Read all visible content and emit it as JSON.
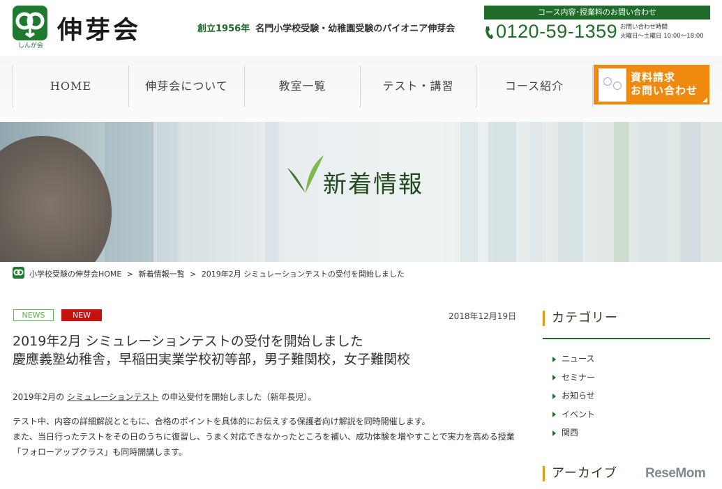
{
  "header": {
    "logo_text": "伸芽会",
    "logo_sub": "しんが会",
    "tagline_founded": "創立1956年",
    "tagline": "名門小学校受験・幼稚園受験のパイオニア伸芽会",
    "inquiry_bar": "コース内容･授業料のお問い合わせ",
    "phone": "0120-59-1359",
    "hours_label": "お問い合わせ時間",
    "hours_value": "火曜日～土曜日 10:00～18:00"
  },
  "nav": {
    "items": [
      {
        "label": "HOME"
      },
      {
        "label": "伸芽会について"
      },
      {
        "label": "教室一覧"
      },
      {
        "label": "テスト・講習"
      },
      {
        "label": "コース紹介"
      }
    ],
    "cta_line1": "資料請求",
    "cta_line2": "お問い合わせ"
  },
  "hero": {
    "title": "新着情報"
  },
  "breadcrumb": {
    "home": "小学校受験の伸芽会HOME",
    "sep": ">",
    "list": "新着情報一覧",
    "current": "2019年2月 シミュレーションテストの受付を開始しました"
  },
  "article": {
    "badge_news": "NEWS",
    "badge_new": "NEW",
    "date": "2018年12月19日",
    "title_line1": "2019年2月 シミュレーションテストの受付を開始しました",
    "title_line2": "慶應義塾幼稚舎，早稲田実業学校初等部，男子難関校，女子難関校",
    "p1_before": "2019年2月の",
    "p1_link": "シミュレーションテスト",
    "p1_after": "の申込受付を開始しました（新年長児）。",
    "p2_line1": "テスト中、内容の詳細解説とともに、合格のポイントを具体的にお伝えする保護者向け解説を同時開催します。",
    "p2_line2": "また、当日行ったテストをその日のうちに復習し、うまく対応できなかったところを補い、成功体験を増やすことで実力を高める授業",
    "p2_line3": "「フォローアップクラス」も同時開講します。"
  },
  "sidebar": {
    "category_heading": "カテゴリー",
    "categories": [
      "ニュース",
      "セミナー",
      "お知らせ",
      "イベント",
      "関西"
    ],
    "archive_heading": "アーカイブ"
  },
  "watermark": "ReseMom",
  "colors": {
    "brand_green": "#1e6b2a",
    "cta_orange": "#ef8a10",
    "new_red": "#c4120f",
    "news_green": "#5fb14b",
    "heading_accent": "#e59a1a"
  }
}
